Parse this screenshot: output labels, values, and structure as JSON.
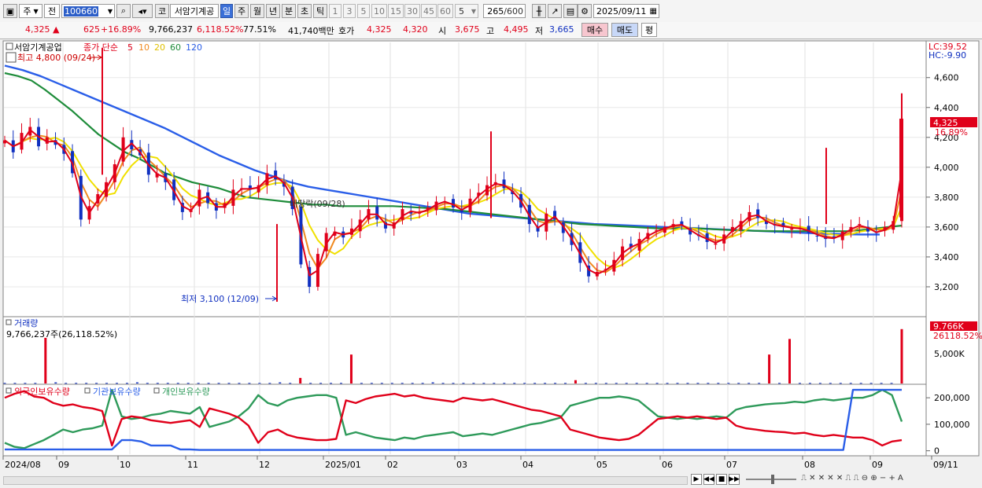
{
  "toolbar": {
    "period_label": "주",
    "prev_label": "전",
    "code_value": "100660",
    "stock_name_label": "코",
    "stock_name": "서암기계공",
    "tf_day": "일",
    "tf_week": "주",
    "tf_month": "월",
    "tf_year": "년",
    "tf_min": "분",
    "tf_sec": "초",
    "tf_tick": "틱",
    "intervals": [
      "1",
      "3",
      "5",
      "10",
      "15",
      "30",
      "45",
      "60"
    ],
    "interval_value": "5",
    "count_value": "265",
    "count_total": "/600",
    "date_value": "2025/09/11"
  },
  "quote": {
    "price": "4,325",
    "change_arrow": "▲",
    "change": "625",
    "change_pct": "+16.89%",
    "volume": "9,766,237",
    "volume_ratio": "6,118.52%",
    "turnover_pct": "77.51%",
    "amount": "41,740백만",
    "bid_label": "호가",
    "bid1": "4,325",
    "bid2": "4,320",
    "open_label": "시",
    "open": "3,675",
    "high_label": "고",
    "high": "4,495",
    "low_label": "저",
    "low": "3,665",
    "buy_label": "매수",
    "sell_label": "매도",
    "avg_label": "평"
  },
  "price_panel": {
    "name_label": "서암기계공업",
    "ma_title": "종가 단순",
    "ma_periods": [
      "5",
      "10",
      "20",
      "60",
      "120"
    ],
    "high_note": "최고 4,800 (09/24)",
    "low_note": "최저 3,100 (12/09)",
    "dividend_note": "배당락(09/28)",
    "lc": "LC:39.52",
    "hc": "HC:-9.90",
    "last_price_tag": "4,325",
    "last_pct_tag": "16.89%"
  },
  "volume_panel": {
    "title": "거래량",
    "info": "9,766,237주(26,118.52%)",
    "tag_value": "9.766K",
    "tag_pct": "26118.52%",
    "axis_label": "5,000K"
  },
  "holdings_panel": {
    "title_foreign": "외국인보유수량",
    "title_inst": "기관보유수량",
    "title_indiv": "개인보유수량"
  },
  "x_axis_labels": [
    "2024/08",
    "09",
    "10",
    "11",
    "12",
    "2025/01",
    "02",
    "03",
    "04",
    "05",
    "06",
    "07",
    "08",
    "09",
    "09/11"
  ],
  "chart_data": {
    "type": "line",
    "price_axis": {
      "ticks": [
        3200,
        3400,
        3600,
        3800,
        4000,
        4200,
        4400,
        4600
      ],
      "ylim": [
        3000,
        4830
      ]
    },
    "vol_axis": {
      "ticks": [
        "5,000K"
      ],
      "ylim": [
        0,
        12000000
      ]
    },
    "holdings_axis": {
      "ticks": [
        0,
        100000,
        200000
      ],
      "ylim": [
        -10000,
        245000
      ]
    },
    "series_close": [
      4180,
      4100,
      4230,
      4270,
      4140,
      4200,
      4150,
      4090,
      3960,
      3650,
      3740,
      3820,
      3900,
      4020,
      4200,
      4120,
      4080,
      3950,
      3960,
      3900,
      3780,
      3700,
      3720,
      3850,
      3760,
      3710,
      3760,
      3850,
      3860,
      3850,
      3880,
      3960,
      3920,
      3870,
      3720,
      3350,
      3200,
      3420,
      3560,
      3570,
      3530,
      3590,
      3650,
      3720,
      3650,
      3590,
      3630,
      3720,
      3690,
      3700,
      3730,
      3770,
      3770,
      3730,
      3700,
      3790,
      3830,
      3880,
      3900,
      3860,
      3820,
      3730,
      3620,
      3570,
      3690,
      3650,
      3560,
      3480,
      3360,
      3270,
      3300,
      3320,
      3380,
      3470,
      3460,
      3520,
      3560,
      3580,
      3600,
      3620,
      3610,
      3550,
      3540,
      3500,
      3490,
      3550,
      3600,
      3640,
      3700,
      3660,
      3620,
      3610,
      3600,
      3590,
      3590,
      3560,
      3540,
      3520,
      3530,
      3570,
      3600,
      3620,
      3570,
      3560,
      3600,
      3640,
      4325
    ],
    "series_ma60": [
      4630,
      4610,
      4580,
      4520,
      4450,
      4380,
      4300,
      4220,
      4160,
      4100,
      4060,
      4010,
      3960,
      3930,
      3900,
      3880,
      3860,
      3830,
      3800,
      3790,
      3780,
      3770,
      3760,
      3750,
      3750,
      3740,
      3740,
      3740,
      3740,
      3740,
      3735,
      3730,
      3725,
      3720,
      3710,
      3700,
      3690,
      3680,
      3670,
      3660,
      3650,
      3640,
      3630,
      3620,
      3615,
      3610,
      3605,
      3600,
      3595,
      3590,
      3590,
      3590,
      3590,
      3585,
      3580,
      3578,
      3575,
      3573,
      3572,
      3572,
      3572,
      3572,
      3572,
      3572,
      3580,
      3590,
      3600,
      3610
    ],
    "series_ma120": [
      4680,
      4650,
      4610,
      4560,
      4510,
      4460,
      4410,
      4360,
      4310,
      4260,
      4200,
      4140,
      4080,
      4030,
      3980,
      3940,
      3900,
      3870,
      3850,
      3830,
      3810,
      3790,
      3770,
      3750,
      3730,
      3710,
      3690,
      3680,
      3670,
      3660,
      3650,
      3640,
      3630,
      3620,
      3615,
      3610,
      3605,
      3600,
      3595,
      3590,
      3585,
      3580,
      3575,
      3570,
      3565,
      3560,
      3555,
      3552,
      3550,
      3550
    ],
    "series_volume_m": [
      0.1,
      0.1,
      0.1,
      0.1,
      8.2,
      0.2,
      0.1,
      0.1,
      0.1,
      0.1,
      0.1,
      0.1,
      0.1,
      0.2,
      0.1,
      0.1,
      0.1,
      0.1,
      0.1,
      0.1,
      0.1,
      0.1,
      0.1,
      0.1,
      0.1,
      0.1,
      0.1,
      0.2,
      0.1,
      1.0,
      0.1,
      0.1,
      0.1,
      0.1,
      5.2,
      0.1,
      0.1,
      0.1,
      0.1,
      0.1,
      0.1,
      0.1,
      0.2,
      0.1,
      0.1,
      0.1,
      0.1,
      0.1,
      0.1,
      0.1,
      0.1,
      0.1,
      0.1,
      0.1,
      0.1,
      0.1,
      0.6,
      0.1,
      0.1,
      0.1,
      0.1,
      0.1,
      0.1,
      0.1,
      0.1,
      0.1,
      0.1,
      0.1,
      0.1,
      0.1,
      0.1,
      0.1,
      0.1,
      0.1,
      0.1,
      5.2,
      0.1,
      8.0,
      0.1,
      0.1,
      0.1,
      0.1,
      0.1,
      0.1,
      0.1,
      0.1,
      0.1,
      0.1,
      9.77
    ],
    "series_foreign": [
      200000,
      215000,
      225000,
      205000,
      200000,
      180000,
      170000,
      175000,
      165000,
      160000,
      150000,
      20000,
      120000,
      130000,
      125000,
      115000,
      110000,
      105000,
      110000,
      115000,
      90000,
      160000,
      150000,
      140000,
      125000,
      95000,
      30000,
      70000,
      80000,
      60000,
      50000,
      45000,
      40000,
      40000,
      45000,
      190000,
      180000,
      195000,
      205000,
      210000,
      215000,
      205000,
      210000,
      200000,
      195000,
      190000,
      185000,
      200000,
      195000,
      190000,
      195000,
      185000,
      175000,
      165000,
      155000,
      150000,
      140000,
      130000,
      80000,
      70000,
      60000,
      50000,
      45000,
      40000,
      45000,
      60000,
      90000,
      120000,
      125000,
      130000,
      125000,
      130000,
      125000,
      120000,
      125000,
      95000,
      85000,
      80000,
      75000,
      72000,
      70000,
      65000,
      68000,
      60000,
      55000,
      60000,
      55000,
      50000,
      50000,
      40000,
      20000,
      35000,
      40000
    ],
    "series_indiv": [
      30000,
      15000,
      10000,
      25000,
      40000,
      60000,
      80000,
      70000,
      80000,
      85000,
      95000,
      230000,
      130000,
      120000,
      125000,
      135000,
      140000,
      150000,
      145000,
      140000,
      165000,
      90000,
      100000,
      110000,
      130000,
      160000,
      210000,
      180000,
      170000,
      190000,
      200000,
      205000,
      210000,
      210000,
      200000,
      60000,
      70000,
      60000,
      50000,
      45000,
      40000,
      50000,
      45000,
      55000,
      60000,
      65000,
      70000,
      55000,
      60000,
      65000,
      60000,
      70000,
      80000,
      90000,
      100000,
      105000,
      115000,
      125000,
      170000,
      180000,
      190000,
      200000,
      200000,
      205000,
      200000,
      190000,
      160000,
      130000,
      125000,
      120000,
      125000,
      120000,
      125000,
      130000,
      125000,
      155000,
      165000,
      170000,
      175000,
      178000,
      180000,
      185000,
      182000,
      190000,
      195000,
      190000,
      195000,
      200000,
      200000,
      210000,
      230000,
      210000,
      110000
    ],
    "series_inst": [
      5000,
      5000,
      5000,
      5000,
      5000,
      5000,
      5000,
      5000,
      5000,
      5000,
      5000,
      5000,
      40000,
      40000,
      35000,
      20000,
      20000,
      20000,
      5000,
      5000,
      3000,
      3000,
      3000,
      3000,
      3000,
      3000,
      3000,
      3000,
      3000,
      3000,
      3000,
      3000,
      3000,
      3000,
      3000,
      3000,
      3000,
      3000,
      3000,
      3000,
      3000,
      3000,
      3000,
      3000,
      3000,
      3000,
      3000,
      3000,
      3000,
      3000,
      3000,
      3000,
      3000,
      3000,
      3000,
      3000,
      3000,
      3000,
      3000,
      3000,
      3000,
      3000,
      3000,
      3000,
      3000,
      3000,
      3000,
      3000,
      3000,
      3000,
      3000,
      3000,
      3000,
      3000,
      3000,
      3000,
      3000,
      3000,
      3000,
      3000,
      3000,
      3000,
      3000,
      3000,
      3000,
      3000,
      3000,
      230000,
      230000,
      230000,
      230000,
      230000,
      230000
    ]
  },
  "colors": {
    "up": "#e0001a",
    "down": "#1030c0",
    "ma5": "#e0001a",
    "ma10": "#f08a20",
    "ma20": "#f0e000",
    "ma60": "#1e8c3a",
    "ma120": "#2a5ee8",
    "foreign": "#e0001a",
    "inst": "#2a5ee8",
    "indiv": "#2e9a5a"
  }
}
